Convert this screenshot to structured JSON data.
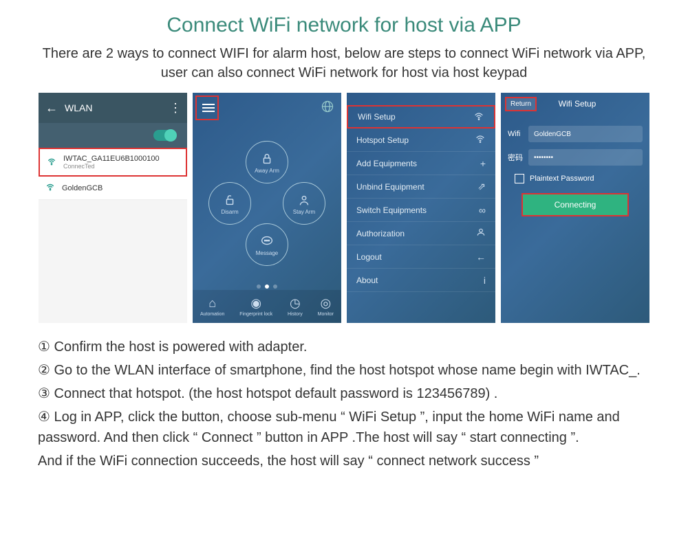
{
  "title": "Connect WiFi network for host via APP",
  "subtitle": "There are 2 ways to connect WIFI for alarm host, below are steps to connect WiFi network via APP, user can also connect WiFi network for host via host keypad",
  "screen1": {
    "header": "WLAN",
    "wifi1_name": "IWTAC_GA11EU6B1000100",
    "wifi1_status": "ConnecTed",
    "wifi2_name": "GoldenGCB"
  },
  "screen2": {
    "away": "Away Arm",
    "disarm": "Disarm",
    "stay": "Stay Arm",
    "message": "Message",
    "nav": [
      "Automation",
      "Fingerprint lock",
      "History",
      "Monitor"
    ]
  },
  "screen3": {
    "items": [
      "Wifi Setup",
      "Hotspot Setup",
      "Add Equipments",
      "Unbind Equipment",
      "Switch Equipments",
      "Authorization",
      "Logout",
      "About"
    ]
  },
  "screen4": {
    "return": "Return",
    "title": "Wifi Setup",
    "wifi_label": "Wifi",
    "wifi_value": "GoldenGCB",
    "pwd_label": "密码",
    "pwd_value": "••••••••",
    "plaintext": "Plaintext Password",
    "connect": "Connecting"
  },
  "steps": {
    "s1": "Confirm the host is powered with adapter.",
    "s2": "Go to the WLAN interface of smartphone, find the host hotspot whose name begin with IWTAC_.",
    "s3": "Connect that hotspot. (the host hotspot default password is 123456789) .",
    "s4": "Log in APP, click the      button, choose sub-menu “ WiFi Setup ”, input the home WiFi name and password. And then click “ Connect ” button in APP .The host will say “  start connecting ”.",
    "final": "And if the WiFi connection succeeds, the host will say “ connect network success ”"
  },
  "nums": [
    "①",
    "②",
    "③",
    "④"
  ]
}
